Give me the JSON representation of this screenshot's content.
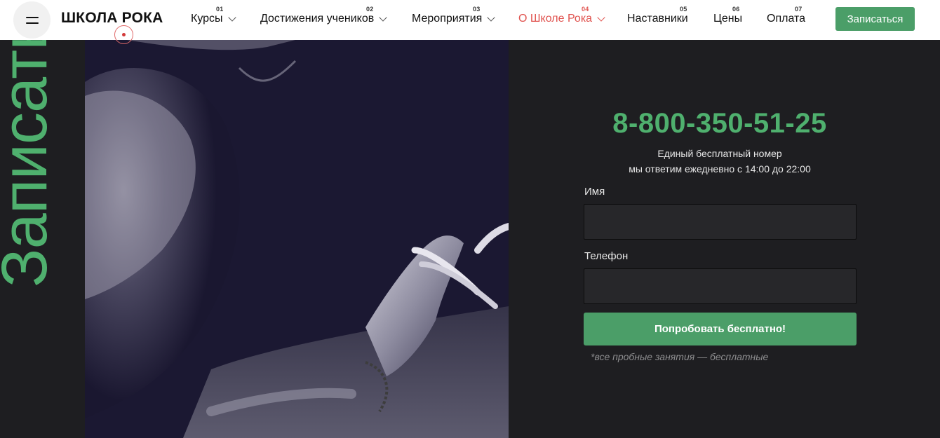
{
  "header": {
    "logo": "ШКОЛА РОКА",
    "nav": [
      {
        "num": "01",
        "label": "Курсы",
        "dropdown": true
      },
      {
        "num": "02",
        "label": "Достижения учеников",
        "dropdown": true
      },
      {
        "num": "03",
        "label": "Мероприятия",
        "dropdown": true
      },
      {
        "num": "04",
        "label": "О Школе Рока",
        "dropdown": true,
        "active": true
      },
      {
        "num": "05",
        "label": "Наставники"
      },
      {
        "num": "06",
        "label": "Цены"
      },
      {
        "num": "07",
        "label": "Оплата"
      }
    ],
    "signup_label": "Записаться"
  },
  "hero": {
    "vertical_title": "Записатьс"
  },
  "form": {
    "phone": "8-800-350-51-25",
    "subtitle_1": "Единый бесплатный номер",
    "subtitle_2": "мы ответим ежедневно с 14:00 до 22:00",
    "name_label": "Имя",
    "name_value": "",
    "phone_label": "Телефон",
    "phone_value": "",
    "submit_label": "Попробовать бесплатно!",
    "note": "*все пробные занятия — бесплатные"
  },
  "colors": {
    "accent_green": "#4b9e68",
    "active_red": "#e0534f",
    "background": "#1e1e21"
  }
}
